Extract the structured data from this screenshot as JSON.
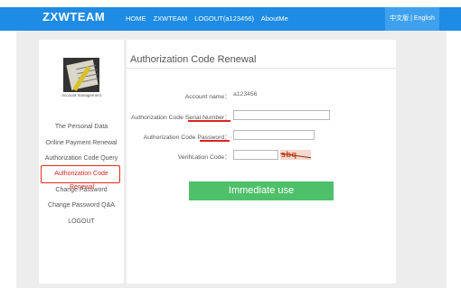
{
  "header": {
    "logo": "ZXWTEAM",
    "nav": [
      "HOME",
      "ZXWTEAM",
      "LOGOUT(a123456)",
      "AboutMe"
    ],
    "lang_cn": "中文版",
    "lang_sep": "|",
    "lang_en": "English"
  },
  "sidebar": {
    "account_label": "Account management",
    "items": [
      {
        "label": "The Personal Data"
      },
      {
        "label": "Online Payment Renewal"
      },
      {
        "label": "Authorization Code Query"
      },
      {
        "label": "Authorization Code"
      },
      {
        "label": "Change Password"
      },
      {
        "label": "Change Password Q&A"
      },
      {
        "label": "LOGOUT"
      }
    ],
    "overlay_text": "Renewal"
  },
  "main": {
    "title": "Authorization Code Renewal",
    "account_name_label": "Account name：",
    "account_name_value": "a123456",
    "serial_label_prefix": "Authorization Code ",
    "serial_label_emph": "Serial Number",
    "serial_label_suffix": "：",
    "serial_value": "",
    "password_label_prefix": "Authorization Code ",
    "password_label_emph": "Password",
    "password_label_suffix": "：",
    "password_value": "",
    "verification_label": "Verification Code：",
    "verification_value": "",
    "captcha_text": "sbq",
    "submit_label": "Immediate use"
  },
  "colors": {
    "header": "#1e8be4",
    "accent_red": "#d9261c",
    "button": "#4fc06a"
  }
}
